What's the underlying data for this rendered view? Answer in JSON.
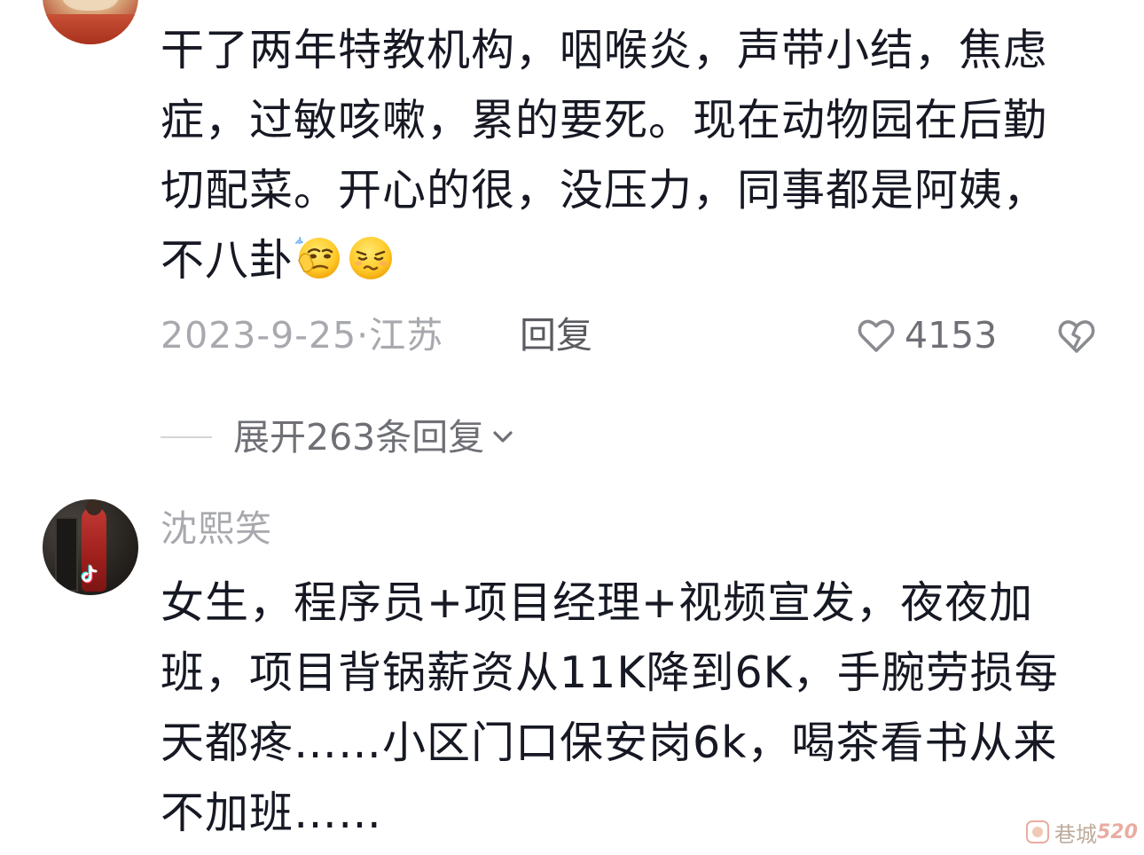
{
  "comments": [
    {
      "text": "干了两年特教机构，咽喉炎，声带小结，焦虑症，过敏咳嗽，累的要死。现在动物园在后勤切配菜。开心的很，没压力，同事都是阿姨，不八卦",
      "emojis": [
        "thinking-face-emoji",
        "smirk-face-emoji"
      ],
      "date_location": "2023-9-25·江苏",
      "reply_label": "回复",
      "like_count": "4153"
    },
    {
      "username": "沈熙笑",
      "text": "女生，程序员+项目经理+视频宣发，夜夜加班，项目背锅薪资从11K降到6K，手腕劳损每天都疼……小区门口保安岗6k，喝茶看书从来不加班……"
    }
  ],
  "expand": {
    "label": "展开263条回复"
  },
  "watermark": {
    "text": "巷城",
    "number": "520"
  },
  "colors": {
    "primary_text": "#161823",
    "secondary_text": "#a8a9ae",
    "action_text": "#5a5b61"
  }
}
